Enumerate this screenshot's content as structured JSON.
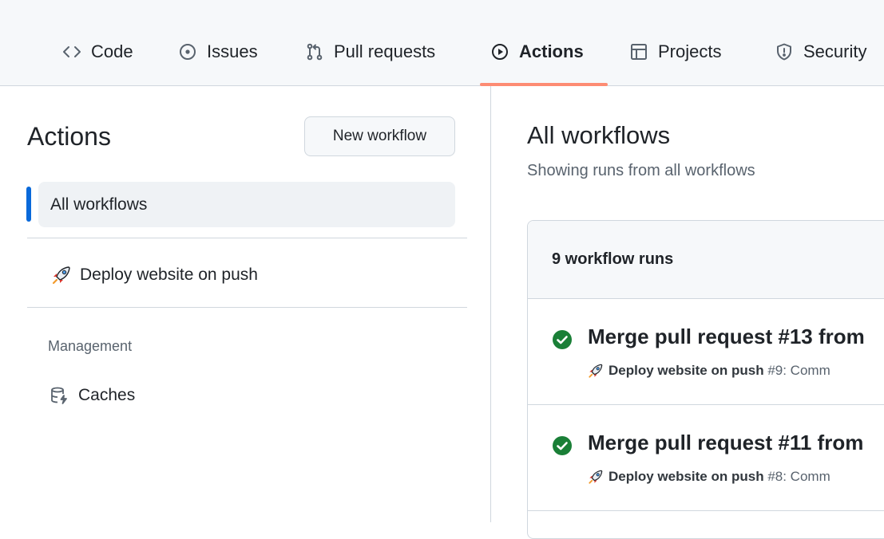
{
  "tabs": [
    {
      "label": "Code",
      "icon": "code-icon"
    },
    {
      "label": "Issues",
      "icon": "issue-opened-icon"
    },
    {
      "label": "Pull requests",
      "icon": "git-pull-request-icon"
    },
    {
      "label": "Actions",
      "icon": "play-icon",
      "selected": true
    },
    {
      "label": "Projects",
      "icon": "table-icon"
    },
    {
      "label": "Security",
      "icon": "shield-icon"
    }
  ],
  "sidebar": {
    "title": "Actions",
    "new_workflow_label": "New workflow",
    "all_workflows_label": "All workflows",
    "workflows": [
      {
        "label": "Deploy website on push",
        "icon": "rocket-icon"
      }
    ],
    "management_label": "Management",
    "management_items": [
      {
        "label": "Caches",
        "icon": "database-icon"
      }
    ]
  },
  "main": {
    "title": "All workflows",
    "subtitle": "Showing runs from all workflows",
    "runs_count_label": "9 workflow runs",
    "runs": [
      {
        "title": "Merge pull request #13 from",
        "workflow": "Deploy website on push",
        "run_suffix": " #9: Comm",
        "status": "success"
      },
      {
        "title": "Merge pull request #11 from",
        "workflow": "Deploy website on push",
        "run_suffix": " #8: Comm",
        "status": "success"
      }
    ]
  },
  "colors": {
    "accent_underline": "#fd8c73",
    "active_bar": "#0969da",
    "success": "#1a7f37"
  }
}
